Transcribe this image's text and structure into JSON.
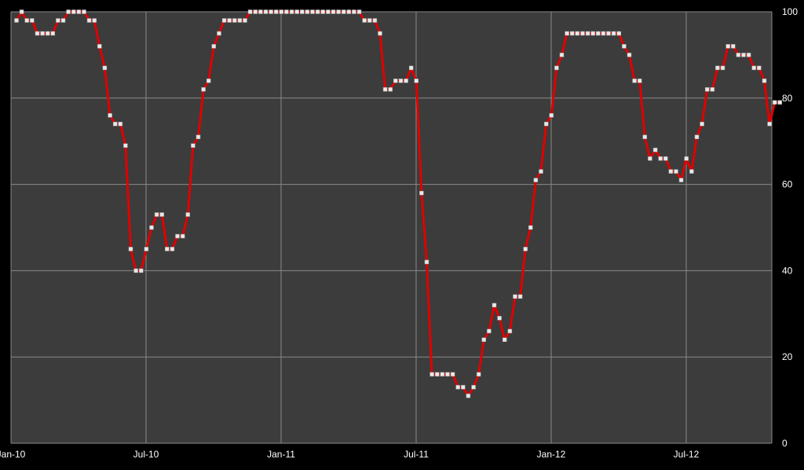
{
  "chart_data": {
    "type": "line",
    "title": "",
    "xlabel": "",
    "ylabel": "",
    "ylim": [
      0,
      100
    ],
    "y_ticks": [
      "0",
      "20",
      "40",
      "60",
      "80",
      "100"
    ],
    "x_tick_labels": [
      "Jan-10",
      "Jul-10",
      "Jan-11",
      "Jul-11",
      "Jan-12",
      "Jul-12"
    ],
    "y_axis_side": "right",
    "grid": true,
    "legend": "none",
    "colors": {
      "background": "#3c3c3c",
      "page": "#000000",
      "gridline": "#8a8a8a",
      "line": "#e00000",
      "marker": "#e8e8e8",
      "text": "#ffffff"
    },
    "x_start": "2010-01",
    "x_step": "1 week",
    "series": [
      {
        "values": [
          98,
          100,
          98,
          98,
          95,
          95,
          95,
          95,
          98,
          98,
          100,
          100,
          100,
          100,
          98,
          98,
          92,
          87,
          76,
          74,
          74,
          69,
          45,
          40,
          40,
          45,
          50,
          53,
          53,
          45,
          45,
          48,
          48,
          53,
          69,
          71,
          82,
          84,
          92,
          95,
          98,
          98,
          98,
          98,
          98,
          100,
          100,
          100,
          100,
          100,
          100,
          100,
          100,
          100,
          100,
          100,
          100,
          100,
          100,
          100,
          100,
          100,
          100,
          100,
          100,
          100,
          100,
          98,
          98,
          98,
          95,
          82,
          82,
          84,
          84,
          84,
          87,
          84,
          58,
          42,
          16,
          16,
          16,
          16,
          16,
          13,
          13,
          11,
          13,
          16,
          24,
          26,
          32,
          29,
          24,
          26,
          34,
          34,
          45,
          50,
          61,
          63,
          74,
          76,
          87,
          90,
          95,
          95,
          95,
          95,
          95,
          95,
          95,
          95,
          95,
          95,
          95,
          92,
          90,
          84,
          84,
          71,
          66,
          68,
          66,
          66,
          63,
          63,
          61,
          66,
          63,
          71,
          74,
          82,
          82,
          87,
          87,
          92,
          92,
          90,
          90,
          90,
          87,
          87,
          84,
          74,
          79,
          79
        ]
      }
    ]
  }
}
